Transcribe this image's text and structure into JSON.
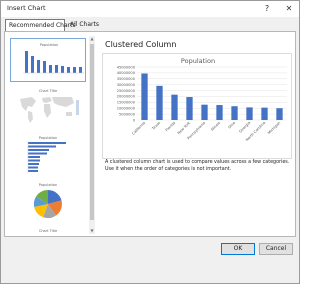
{
  "window": {
    "title": "Insert Chart",
    "help_label": "?",
    "close_label": "✕"
  },
  "tabs": {
    "recommended": "Recommended Charts",
    "all": "All Charts"
  },
  "preview": {
    "heading": "Clustered Column",
    "description": "A clustered column chart is used to compare values across a few categories. Use it when the order of categories is not important."
  },
  "buttons": {
    "ok": "OK",
    "cancel": "Cancel"
  },
  "colors": {
    "accent": "#0078d7",
    "series": "#4472c4",
    "series_orange": "#ed7d31",
    "series_gray": "#a5a5a5",
    "series_gold": "#ffc000"
  },
  "thumbnails": [
    {
      "type": "column",
      "title": "Population",
      "selected": true
    },
    {
      "type": "map",
      "title": "Chart Title",
      "selected": false
    },
    {
      "type": "bar",
      "title": "Population",
      "selected": false
    },
    {
      "type": "pie",
      "title": "Population",
      "selected": false
    },
    {
      "type": "funnel",
      "title": "Chart Title",
      "selected": false
    }
  ],
  "chart_data": {
    "type": "bar",
    "title": "Population",
    "categories": [
      "California",
      "Texas",
      "Florida",
      "New York",
      "Pennsylvania",
      "Illinois",
      "Ohio",
      "Georgia",
      "North Carolina",
      "Michigan"
    ],
    "values": [
      39500000,
      29000000,
      21500000,
      19500000,
      13000000,
      12700000,
      11700000,
      10700000,
      10500000,
      10000000
    ],
    "ylim": [
      0,
      45000000
    ],
    "yticks": [
      "0",
      "5000000",
      "10000000",
      "15000000",
      "20000000",
      "25000000",
      "30000000",
      "35000000",
      "40000000",
      "45000000"
    ],
    "grid": true,
    "xlabel": "",
    "ylabel": ""
  }
}
